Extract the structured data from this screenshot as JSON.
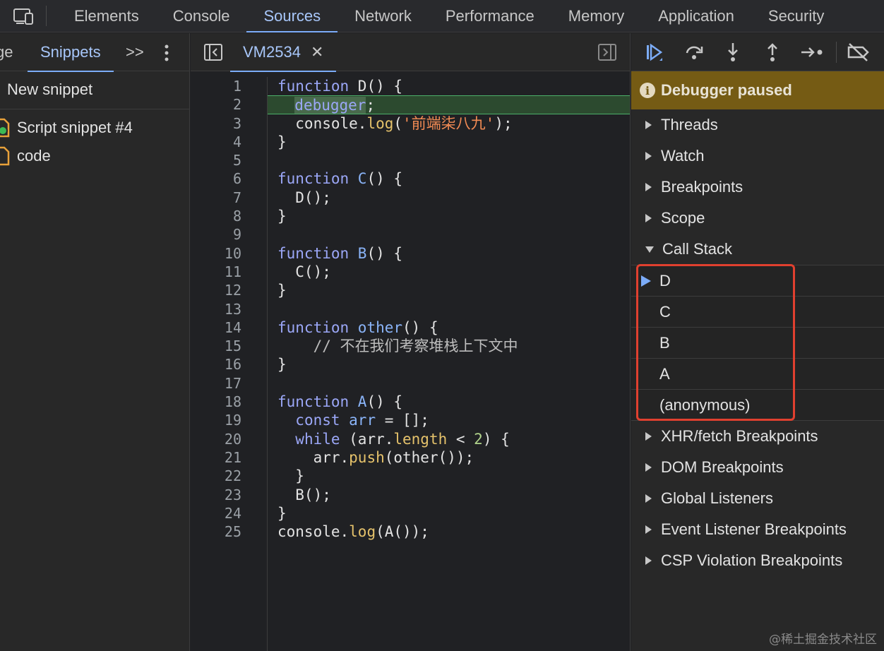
{
  "top_tabs": [
    "Elements",
    "Console",
    "Sources",
    "Network",
    "Performance",
    "Memory",
    "Application",
    "Security"
  ],
  "active_top_tab": "Sources",
  "navigator": {
    "partial_tab": "ge",
    "active_tab": "Snippets",
    "more": ">>",
    "new_snippet": "New snippet",
    "snippets": [
      "Script snippet #4",
      "code"
    ]
  },
  "editor": {
    "file_tab": "VM2534",
    "close_glyph": "✕",
    "line_numbers": [
      "1",
      "2",
      "3",
      "4",
      "5",
      "6",
      "7",
      "8",
      "9",
      "10",
      "11",
      "12",
      "13",
      "14",
      "15",
      "16",
      "17",
      "18",
      "19",
      "20",
      "21",
      "22",
      "23",
      "24",
      "25"
    ],
    "code": {
      "l1_kw": "function",
      "l1_rest": " D() {",
      "l2_indent": "  ",
      "l2_kw": "debugger",
      "l2_rest": ";",
      "l3_a": "  console.",
      "l3_prop": "log",
      "l3_b": "(",
      "l3_str": "'前端柒八九'",
      "l3_c": ");",
      "l4": "}",
      "l6_kw": "function",
      "l6_fn": " C",
      "l6_rest": "() {",
      "l7": "  D();",
      "l8": "}",
      "l10_kw": "function",
      "l10_fn": " B",
      "l10_rest": "() {",
      "l11": "  C();",
      "l12": "}",
      "l14_kw": "function",
      "l14_fn": " other",
      "l14_rest": "() {",
      "l15": "    // 不在我们考察堆栈上下文中",
      "l16": "}",
      "l18_kw": "function",
      "l18_fn": " A",
      "l18_rest": "() {",
      "l19_a": "  ",
      "l19_kw": "const",
      "l19_var": " arr",
      "l19_rest": " = [];",
      "l20_a": "  ",
      "l20_kw": "while",
      "l20_b": " (arr.",
      "l20_prop": "length",
      "l20_c": " < ",
      "l20_num": "2",
      "l20_d": ") {",
      "l21_a": "    arr.",
      "l21_prop": "push",
      "l21_b": "(other());",
      "l22": "  }",
      "l23": "  B();",
      "l24": "}",
      "l25_a": "console.",
      "l25_prop": "log",
      "l25_b": "(A());"
    }
  },
  "debugger": {
    "paused_text": "Debugger paused",
    "sections_top": [
      "Threads",
      "Watch",
      "Breakpoints",
      "Scope"
    ],
    "call_stack_label": "Call Stack",
    "call_stack": [
      "D",
      "C",
      "B",
      "A",
      "(anonymous)"
    ],
    "sections_bottom": [
      "XHR/fetch Breakpoints",
      "DOM Breakpoints",
      "Global Listeners",
      "Event Listener Breakpoints",
      "CSP Violation Breakpoints"
    ]
  },
  "watermark": "@稀土掘金技术社区"
}
